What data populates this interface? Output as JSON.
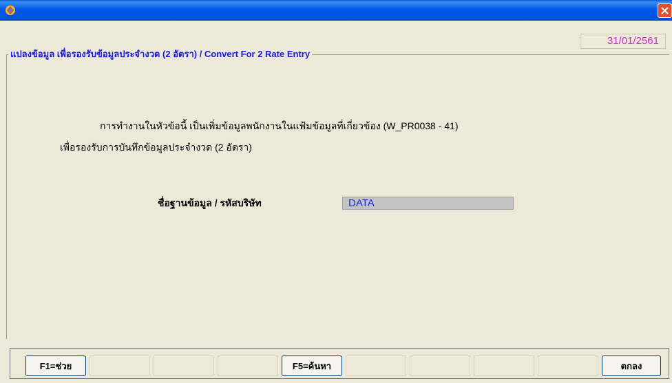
{
  "window": {
    "app_icon": "app-logo-icon",
    "close_icon": "close-icon"
  },
  "header": {
    "date": "31/01/2561"
  },
  "group": {
    "title": "แปลงข้อมูล เพื่อรองรับข้อมูลประจำงวด (2 อัตรา) / Convert For 2 Rate Entry"
  },
  "description": {
    "line1": "การทำงานในหัวข้อนี้ เป็นเพิ่มข้อมูลพนักงานในแฟ้มข้อมูลที่เกี่ยวข้อง (W_PR0038 - 41)",
    "line2": "เพื่อรองรับการบันทึกข้อมูลประจำงวด (2 อัตรา)"
  },
  "database": {
    "label": "ชื่อฐานข้อมูล / รหัสบริษัท",
    "value": "DATA"
  },
  "function_keys": {
    "f1": "F1=ช่วย",
    "f5": "F5=ค้นหา",
    "ok": "ตกลง"
  },
  "colors": {
    "title_blue": "#1a1ad8",
    "date_magenta": "#d02ad0",
    "field_text_blue": "#1a2fd0",
    "window_bg": "#ece9d8",
    "titlebar_blue": "#0054e3",
    "close_red": "#e0502e"
  }
}
